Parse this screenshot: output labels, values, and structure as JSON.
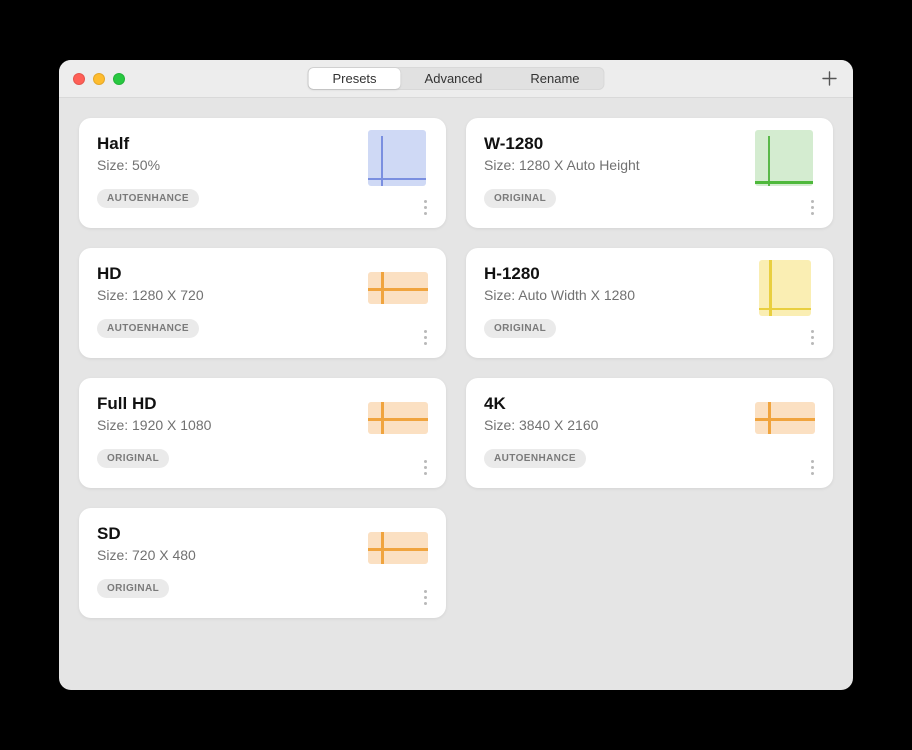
{
  "tabs": {
    "presets": "Presets",
    "advanced": "Advanced",
    "rename": "Rename",
    "active": "presets"
  },
  "presets": [
    {
      "title": "Half",
      "size": "Size: 50%",
      "tag": "AUTOENHANCE",
      "thumb": "blue"
    },
    {
      "title": "W-1280",
      "size": "Size: 1280 X Auto Height",
      "tag": "ORIGINAL",
      "thumb": "green"
    },
    {
      "title": "HD",
      "size": "Size: 1280 X 720",
      "tag": "AUTOENHANCE",
      "thumb": "orange-wide"
    },
    {
      "title": "H-1280",
      "size": "Size: Auto Width X 1280",
      "tag": "ORIGINAL",
      "thumb": "yellow-tall"
    },
    {
      "title": "Full HD",
      "size": "Size: 1920 X 1080",
      "tag": "ORIGINAL",
      "thumb": "orange-wide"
    },
    {
      "title": "4K",
      "size": "Size: 3840 X 2160",
      "tag": "AUTOENHANCE",
      "thumb": "orange-wide"
    },
    {
      "title": "SD",
      "size": "Size: 720 X 480",
      "tag": "ORIGINAL",
      "thumb": "orange-wide"
    }
  ]
}
